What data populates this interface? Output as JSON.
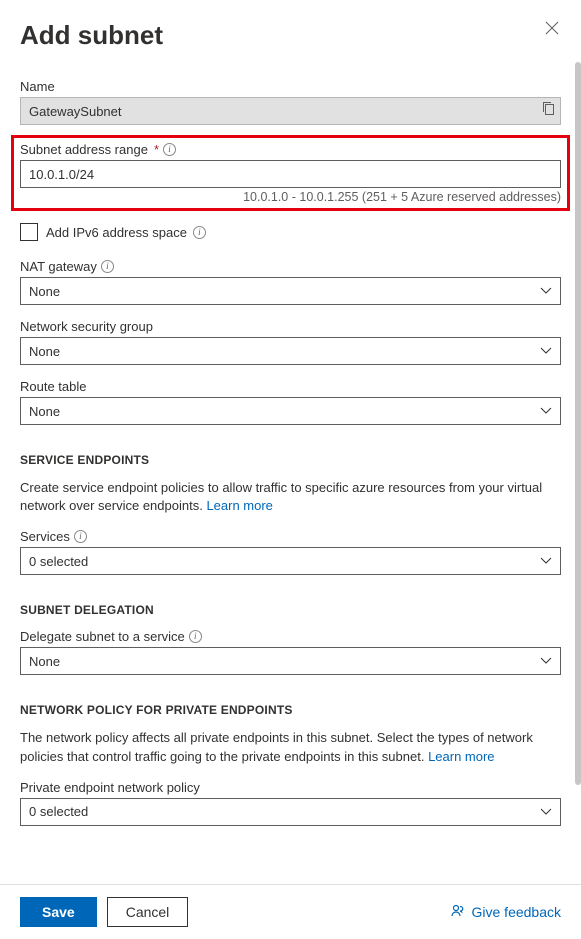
{
  "header": {
    "title": "Add subnet"
  },
  "name": {
    "label": "Name",
    "value": "GatewaySubnet"
  },
  "addressRange": {
    "label": "Subnet address range",
    "required": true,
    "value": "10.0.1.0/24",
    "hint": "10.0.1.0 - 10.0.1.255 (251 + 5 Azure reserved addresses)"
  },
  "ipv6": {
    "label": "Add IPv6 address space"
  },
  "natGateway": {
    "label": "NAT gateway",
    "value": "None"
  },
  "nsg": {
    "label": "Network security group",
    "value": "None"
  },
  "routeTable": {
    "label": "Route table",
    "value": "None"
  },
  "serviceEndpoints": {
    "heading": "SERVICE ENDPOINTS",
    "desc": "Create service endpoint policies to allow traffic to specific azure resources from your virtual network over service endpoints. ",
    "learnMore": "Learn more",
    "servicesLabel": "Services",
    "servicesValue": "0 selected"
  },
  "delegation": {
    "heading": "SUBNET DELEGATION",
    "label": "Delegate subnet to a service",
    "value": "None"
  },
  "networkPolicy": {
    "heading": "NETWORK POLICY FOR PRIVATE ENDPOINTS",
    "desc": "The network policy affects all private endpoints in this subnet. Select the types of network policies that control traffic going to the private endpoints in this subnet. ",
    "learnMore": "Learn more",
    "label": "Private endpoint network policy",
    "value": "0 selected"
  },
  "footer": {
    "save": "Save",
    "cancel": "Cancel",
    "feedback": "Give feedback"
  }
}
